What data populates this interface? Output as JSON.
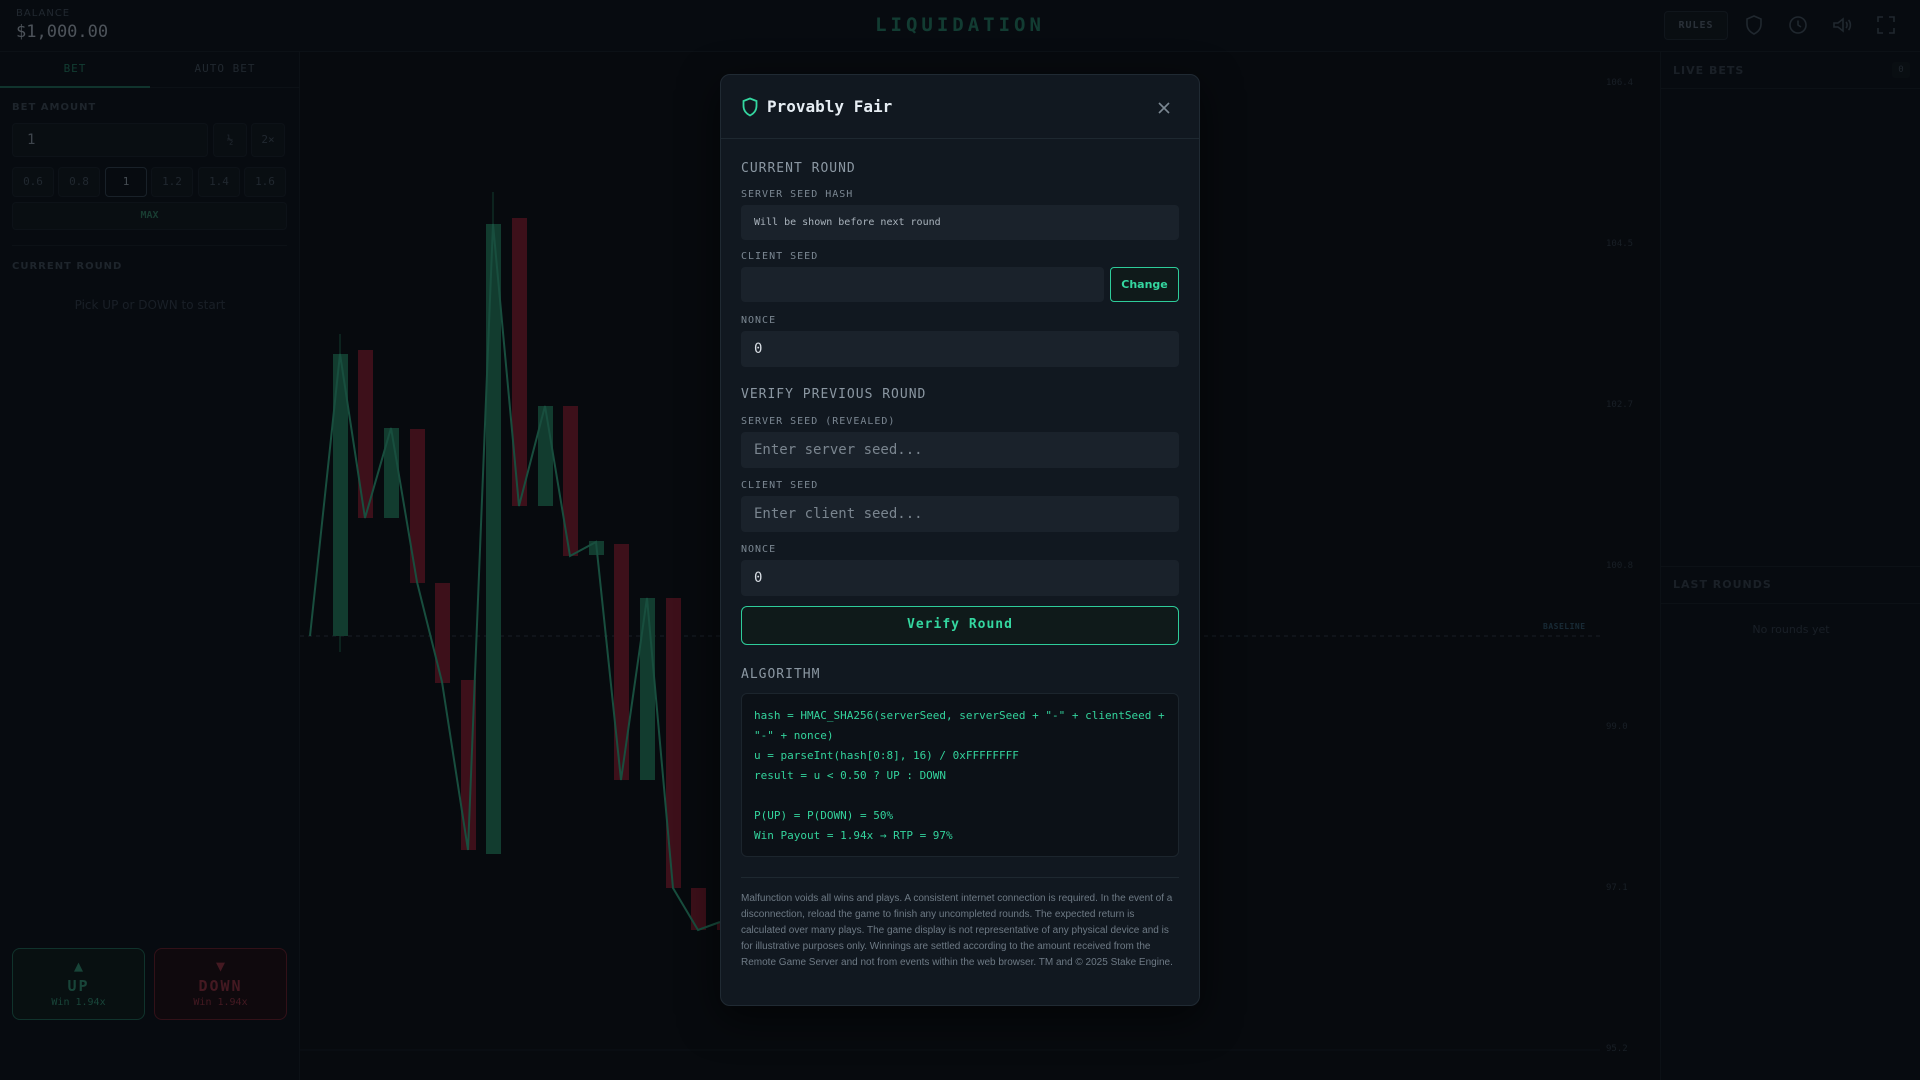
{
  "header": {
    "balance_label": "BALANCE",
    "balance_value": "$1,000.00",
    "logo": "LIQUIDATION",
    "rules_label": "RULES",
    "icons": [
      "shield-icon",
      "clock-icon",
      "volume-icon",
      "fullscreen-icon"
    ]
  },
  "left_panel": {
    "tabs": [
      "BET",
      "AUTO BET"
    ],
    "active_tab": "BET",
    "bet_amount_label": "BET AMOUNT",
    "bet_amount_value": "1",
    "half_label": "½",
    "double_label": "2×",
    "chips": [
      "0.6",
      "0.8",
      "1",
      "1.2",
      "1.4",
      "1.6"
    ],
    "active_chip": "1",
    "max_label": "MAX",
    "current_round_label": "CURRENT ROUND",
    "current_round_hint": "Pick UP or DOWN to start",
    "up_button": {
      "label": "UP",
      "sub": "Win 1.94x",
      "arrow": "▲"
    },
    "down_button": {
      "label": "DOWN",
      "sub": "Win 1.94x",
      "arrow": "▼"
    }
  },
  "chart": {
    "y_ticks": [
      "106.4",
      "104.5",
      "102.7",
      "100.8",
      "99.0",
      "97.1",
      "95.2"
    ],
    "baseline_label": "BASELINE",
    "colors": {
      "up": "#1f6b4f",
      "down": "#6e1a28",
      "line": "#2b8a6a"
    }
  },
  "right_panel": {
    "live_bets_title": "LIVE BETS",
    "live_bets_count": "0",
    "last_rounds_title": "LAST ROUNDS",
    "last_rounds_empty": "No rounds yet"
  },
  "modal": {
    "title": "Provably Fair",
    "current_round_section": "CURRENT ROUND",
    "server_seed_hash_label": "SERVER SEED HASH",
    "server_seed_hash_value": "Will be shown before next round",
    "client_seed_label": "CLIENT SEED",
    "client_seed_value": "",
    "change_label": "Change",
    "nonce_label": "NONCE",
    "nonce_value": "0",
    "verify_section": "VERIFY PREVIOUS ROUND",
    "server_seed_revealed_label": "SERVER SEED (REVEALED)",
    "server_seed_placeholder": "Enter server seed...",
    "verify_client_seed_label": "CLIENT SEED",
    "client_seed_placeholder": "Enter client seed...",
    "verify_nonce_label": "NONCE",
    "verify_nonce_value": "0",
    "verify_button": "Verify Round",
    "algorithm_section": "ALGORITHM",
    "algorithm_lines": [
      "hash = HMAC_SHA256(serverSeed, serverSeed + \"-\" + clientSeed +",
      "\"-\" + nonce)",
      "u = parseInt(hash[0:8], 16) / 0xFFFFFFFF",
      "result = u < 0.50 ? UP : DOWN",
      "",
      "P(UP) = P(DOWN) = 50%",
      "Win Payout = 1.94x → RTP = 97%"
    ],
    "disclaimer": "Malfunction voids all wins and plays. A consistent internet connection is required. In the event of a disconnection, reload the game to finish any uncompleted rounds. The expected return is calculated over many plays. The game display is not representative of any physical device and is for illustrative purposes only. Winnings are settled according to the amount received from the Remote Game Server and not from events within the web browser. TM and © 2025 Stake Engine.",
    "accent_color": "#2ecc9a"
  }
}
